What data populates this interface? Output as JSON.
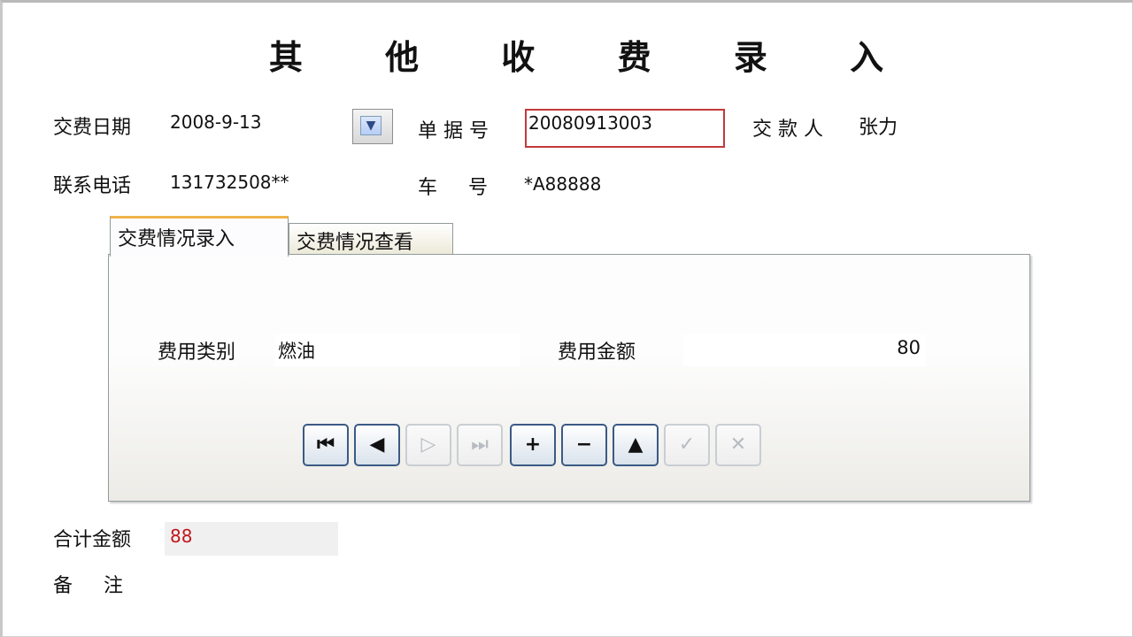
{
  "title": "其 他 收 费 录 入",
  "header": {
    "pay_date_label": "交费日期",
    "pay_date_value": "2008-9-13",
    "bill_no_label": "单 据 号",
    "bill_no_value": "20080913003",
    "payer_label": "交 款 人",
    "payer_value": "张力",
    "phone_label": "联系电话",
    "phone_value": "131732508**",
    "car_label": "车     号",
    "car_value": "*A88888"
  },
  "tabs": [
    {
      "label": "交费情况录入",
      "active": true
    },
    {
      "label": "交费情况查看",
      "active": false
    }
  ],
  "panel": {
    "fee_type_label": "费用类别",
    "fee_type_value": "燃油",
    "fee_amount_label": "费用金额",
    "fee_amount_value": "80"
  },
  "navigator": [
    {
      "icon": "first-record-icon",
      "glyph": "⏮",
      "enabled": true
    },
    {
      "icon": "prior-record-icon",
      "glyph": "◀",
      "enabled": true
    },
    {
      "icon": "next-record-icon",
      "glyph": "▷",
      "enabled": false
    },
    {
      "icon": "last-record-icon",
      "glyph": "⏭",
      "enabled": false
    },
    {
      "icon": "insert-record-icon",
      "glyph": "+",
      "enabled": true
    },
    {
      "icon": "delete-record-icon",
      "glyph": "−",
      "enabled": true
    },
    {
      "icon": "edit-record-icon",
      "glyph": "▲",
      "enabled": true
    },
    {
      "icon": "post-record-icon",
      "glyph": "✓",
      "enabled": false
    },
    {
      "icon": "cancel-record-icon",
      "glyph": "✕",
      "enabled": false
    }
  ],
  "footer": {
    "total_label": "合计金额",
    "total_value": "88",
    "remark_label": "备     注"
  },
  "colors": {
    "total_value": "#c0171b",
    "bill_input_border": "#c23a3a",
    "active_tab_accent": "#f0b34a"
  }
}
